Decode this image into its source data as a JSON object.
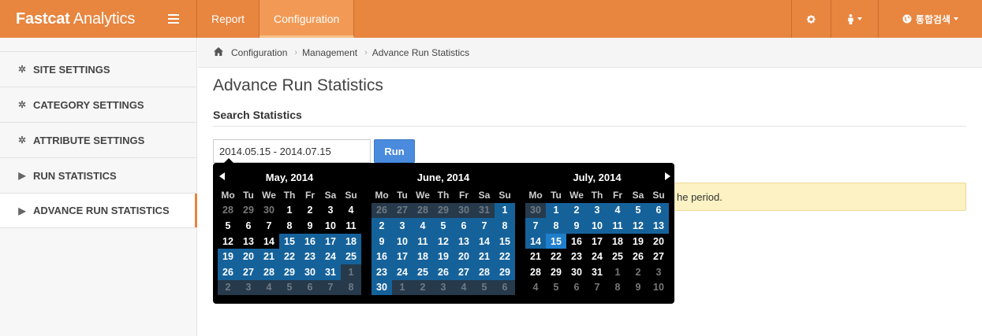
{
  "app": {
    "brand_bold": "Fastcat",
    "brand_rest": " Analytics"
  },
  "topnav": {
    "tabs": [
      {
        "label": "Report",
        "active": false
      },
      {
        "label": "Configuration",
        "active": true
      }
    ],
    "search_label": "통합검색"
  },
  "sidebar": {
    "items": [
      {
        "label": "SITE SETTINGS",
        "icon": "gear-icon",
        "active": false
      },
      {
        "label": "CATEGORY SETTINGS",
        "icon": "gear-icon",
        "active": false
      },
      {
        "label": "ATTRIBUTE SETTINGS",
        "icon": "gear-icon",
        "active": false
      },
      {
        "label": "RUN STATISTICS",
        "icon": "play-icon",
        "active": false
      },
      {
        "label": "ADVANCE RUN STATISTICS",
        "icon": "play-icon",
        "active": true
      }
    ]
  },
  "breadcrumb": [
    "Configuration",
    "Management",
    "Advance Run Statistics"
  ],
  "main": {
    "title": "Advance Run Statistics",
    "section_title": "Search Statistics",
    "date_range_value": "2014.05.15 - 2014.07.15",
    "run_label": "Run",
    "alert_text": "he period."
  },
  "datepicker": {
    "weekdays": [
      "Mo",
      "Tu",
      "We",
      "Th",
      "Fr",
      "Sa",
      "Su"
    ],
    "months": [
      {
        "title": "May, 2014",
        "weeks": [
          [
            [
              28,
              "off",
              ""
            ],
            [
              29,
              "off",
              ""
            ],
            [
              30,
              "off",
              ""
            ],
            [
              1,
              "",
              ""
            ],
            [
              2,
              "",
              ""
            ],
            [
              3,
              "",
              ""
            ],
            [
              4,
              "",
              ""
            ]
          ],
          [
            [
              5,
              "",
              ""
            ],
            [
              6,
              "",
              ""
            ],
            [
              7,
              "",
              ""
            ],
            [
              8,
              "",
              ""
            ],
            [
              9,
              "",
              ""
            ],
            [
              10,
              "",
              ""
            ],
            [
              11,
              "",
              ""
            ]
          ],
          [
            [
              12,
              "",
              ""
            ],
            [
              13,
              "",
              ""
            ],
            [
              14,
              "",
              ""
            ],
            [
              15,
              "",
              "in"
            ],
            [
              16,
              "",
              "in"
            ],
            [
              17,
              "",
              "in"
            ],
            [
              18,
              "",
              "in"
            ]
          ],
          [
            [
              19,
              "",
              "in"
            ],
            [
              20,
              "",
              "in"
            ],
            [
              21,
              "",
              "in"
            ],
            [
              22,
              "",
              "in"
            ],
            [
              23,
              "",
              "in"
            ],
            [
              24,
              "",
              "in"
            ],
            [
              25,
              "",
              "in"
            ]
          ],
          [
            [
              26,
              "",
              "in"
            ],
            [
              27,
              "",
              "in"
            ],
            [
              28,
              "",
              "in"
            ],
            [
              29,
              "",
              "in"
            ],
            [
              30,
              "",
              "in"
            ],
            [
              31,
              "",
              "in"
            ],
            [
              1,
              "off",
              "in"
            ]
          ],
          [
            [
              2,
              "off",
              "in"
            ],
            [
              3,
              "off",
              "in"
            ],
            [
              4,
              "off",
              "in"
            ],
            [
              5,
              "off",
              "in"
            ],
            [
              6,
              "off",
              "in"
            ],
            [
              7,
              "off",
              "in"
            ],
            [
              8,
              "off",
              "in"
            ]
          ]
        ]
      },
      {
        "title": "June, 2014",
        "weeks": [
          [
            [
              26,
              "off",
              "in"
            ],
            [
              27,
              "off",
              "in"
            ],
            [
              28,
              "off",
              "in"
            ],
            [
              29,
              "off",
              "in"
            ],
            [
              30,
              "off",
              "in"
            ],
            [
              31,
              "off",
              "in"
            ],
            [
              1,
              "",
              "in"
            ]
          ],
          [
            [
              2,
              "",
              "in"
            ],
            [
              3,
              "",
              "in"
            ],
            [
              4,
              "",
              "in"
            ],
            [
              5,
              "",
              "in"
            ],
            [
              6,
              "",
              "in"
            ],
            [
              7,
              "",
              "in"
            ],
            [
              8,
              "",
              "in"
            ]
          ],
          [
            [
              9,
              "",
              "in"
            ],
            [
              10,
              "",
              "in"
            ],
            [
              11,
              "",
              "in"
            ],
            [
              12,
              "",
              "in"
            ],
            [
              13,
              "",
              "in"
            ],
            [
              14,
              "",
              "in"
            ],
            [
              15,
              "",
              "in"
            ]
          ],
          [
            [
              16,
              "",
              "in"
            ],
            [
              17,
              "",
              "in"
            ],
            [
              18,
              "",
              "in"
            ],
            [
              19,
              "",
              "in"
            ],
            [
              20,
              "",
              "in"
            ],
            [
              21,
              "",
              "in"
            ],
            [
              22,
              "",
              "in"
            ]
          ],
          [
            [
              23,
              "",
              "in"
            ],
            [
              24,
              "",
              "in"
            ],
            [
              25,
              "",
              "in"
            ],
            [
              26,
              "",
              "in"
            ],
            [
              27,
              "",
              "in"
            ],
            [
              28,
              "",
              "in"
            ],
            [
              29,
              "",
              "in"
            ]
          ],
          [
            [
              30,
              "",
              "in"
            ],
            [
              1,
              "off",
              "in"
            ],
            [
              2,
              "off",
              "in"
            ],
            [
              3,
              "off",
              "in"
            ],
            [
              4,
              "off",
              "in"
            ],
            [
              5,
              "off",
              "in"
            ],
            [
              6,
              "off",
              "in"
            ]
          ]
        ]
      },
      {
        "title": "July, 2014",
        "weeks": [
          [
            [
              30,
              "off",
              "in"
            ],
            [
              1,
              "",
              "in"
            ],
            [
              2,
              "",
              "in"
            ],
            [
              3,
              "",
              "in"
            ],
            [
              4,
              "",
              "in"
            ],
            [
              5,
              "",
              "in"
            ],
            [
              6,
              "",
              "in"
            ]
          ],
          [
            [
              7,
              "",
              "in"
            ],
            [
              8,
              "",
              "in"
            ],
            [
              9,
              "",
              "in"
            ],
            [
              10,
              "",
              "in"
            ],
            [
              11,
              "",
              "in"
            ],
            [
              12,
              "",
              "in"
            ],
            [
              13,
              "",
              "in"
            ]
          ],
          [
            [
              14,
              "",
              "in"
            ],
            [
              15,
              "",
              "end"
            ],
            [
              16,
              "",
              ""
            ],
            [
              17,
              "",
              ""
            ],
            [
              18,
              "",
              ""
            ],
            [
              19,
              "",
              ""
            ],
            [
              20,
              "",
              ""
            ]
          ],
          [
            [
              21,
              "",
              ""
            ],
            [
              22,
              "",
              ""
            ],
            [
              23,
              "",
              ""
            ],
            [
              24,
              "",
              ""
            ],
            [
              25,
              "",
              ""
            ],
            [
              26,
              "",
              ""
            ],
            [
              27,
              "",
              ""
            ]
          ],
          [
            [
              28,
              "",
              ""
            ],
            [
              29,
              "",
              ""
            ],
            [
              30,
              "",
              ""
            ],
            [
              31,
              "",
              ""
            ],
            [
              1,
              "off",
              ""
            ],
            [
              2,
              "off",
              ""
            ],
            [
              3,
              "off",
              ""
            ]
          ],
          [
            [
              4,
              "off",
              ""
            ],
            [
              5,
              "off",
              ""
            ],
            [
              6,
              "off",
              ""
            ],
            [
              7,
              "off",
              ""
            ],
            [
              8,
              "off",
              ""
            ],
            [
              9,
              "off",
              ""
            ],
            [
              10,
              "off",
              ""
            ]
          ]
        ]
      }
    ]
  }
}
